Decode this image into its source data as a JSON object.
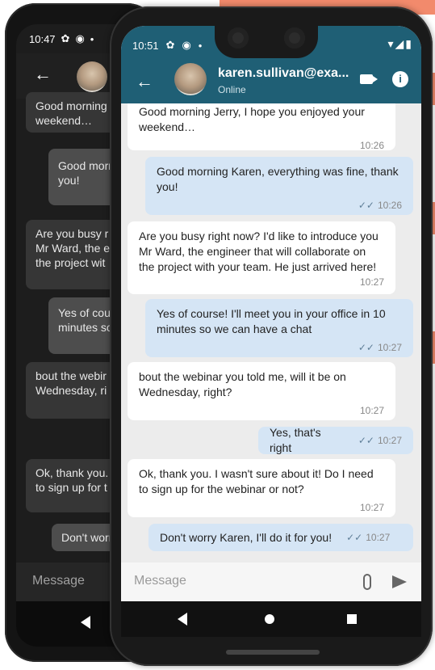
{
  "back_phone": {
    "status_time": "10:47",
    "messages": [
      {
        "dir": "in",
        "text": "Good morning"
      },
      {
        "dir": "in",
        "text": "weekend…"
      },
      {
        "dir": "out",
        "text": "Good morr"
      },
      {
        "dir": "out",
        "text": "you!"
      },
      {
        "dir": "in",
        "text": "Are you busy r"
      },
      {
        "dir": "in",
        "text": "Mr Ward, the e"
      },
      {
        "dir": "in",
        "text": "the project wit"
      },
      {
        "dir": "out",
        "text": "Yes of cour"
      },
      {
        "dir": "out",
        "text": "minutes so"
      },
      {
        "dir": "in",
        "text": "bout the webir"
      },
      {
        "dir": "in",
        "text": "Wednesday, ri"
      },
      {
        "dir": "in",
        "text": "Ok, thank you."
      },
      {
        "dir": "in",
        "text": "to sign up for t"
      },
      {
        "dir": "out",
        "text": "Don't worr"
      }
    ],
    "composer_placeholder": "Message"
  },
  "front_phone": {
    "status_time": "10:51",
    "contact_name": "karen.sullivan@exa...",
    "presence": "Online",
    "composer_placeholder": "Message",
    "messages": [
      {
        "dir": "in",
        "text": "Good morning Jerry, I hope you enjoyed your weekend…",
        "time": "10:26",
        "read": false
      },
      {
        "dir": "out",
        "text": "Good morning Karen, everything was fine, thank you!",
        "time": "10:26",
        "read": true
      },
      {
        "dir": "in",
        "text": "Are you busy right now? I'd like to introduce you Mr Ward, the engineer that will collaborate on the project with your team. He just arrived here!",
        "time": "10:27",
        "read": false
      },
      {
        "dir": "out",
        "text": "Yes of course! I'll meet you in your office in 10 minutes so we can have a chat",
        "time": "10:27",
        "read": true
      },
      {
        "dir": "in",
        "text": "bout the webinar you told me, will it be on Wednesday, right?",
        "time": "10:27",
        "read": false
      },
      {
        "dir": "out",
        "text": "Yes, that's right",
        "time": "10:27",
        "read": true
      },
      {
        "dir": "in",
        "text": "Ok, thank you. I wasn't sure about it! Do I need to sign up for the webinar or not?",
        "time": "10:27",
        "read": false
      },
      {
        "dir": "out",
        "text": "Don't worry Karen, I'll do it for you!",
        "time": "10:27",
        "read": true
      }
    ]
  },
  "colors": {
    "header": "#1f5f75",
    "outgoing_bubble": "#d5e5f5",
    "incoming_bubble": "#ffffff",
    "chat_background": "#ececec",
    "accent_background": "#f28a6c"
  },
  "icons": [
    "back-arrow-icon",
    "settings-gear-icon",
    "sync-icon",
    "video-call-icon",
    "info-icon",
    "attach-icon",
    "send-icon",
    "wifi-icon",
    "signal-icon",
    "battery-icon",
    "nav-back-icon",
    "nav-home-icon",
    "nav-recents-icon",
    "read-ticks-icon"
  ]
}
